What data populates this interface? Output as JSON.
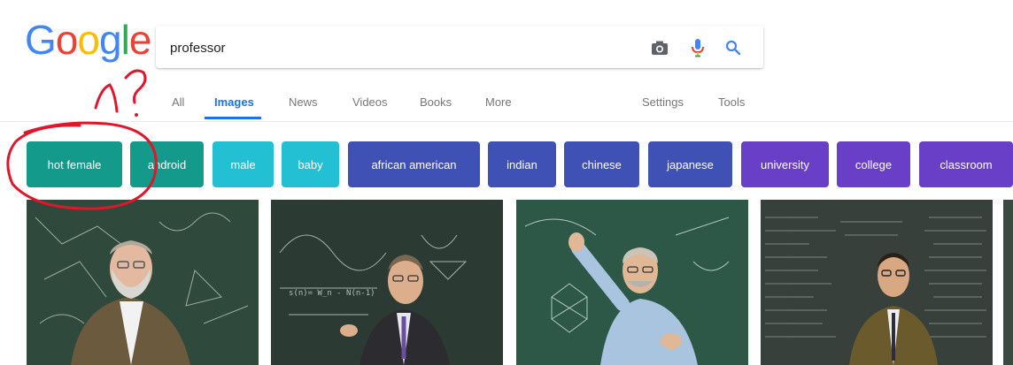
{
  "logo": {
    "letters": [
      "G",
      "o",
      "o",
      "g",
      "l",
      "e"
    ],
    "colors": [
      "#4285F4",
      "#EA4335",
      "#FBBC05",
      "#4285F4",
      "#34A853",
      "#EA4335"
    ]
  },
  "search": {
    "query": "professor",
    "camera_icon": "camera-icon",
    "mic_icon": "microphone-icon",
    "search_icon": "search-icon"
  },
  "tabs": {
    "items": [
      {
        "label": "All"
      },
      {
        "label": "Images",
        "active": true
      },
      {
        "label": "News"
      },
      {
        "label": "Videos"
      },
      {
        "label": "Books"
      },
      {
        "label": "More"
      }
    ],
    "settings_label": "Settings",
    "tools_label": "Tools",
    "accent": "#1a73e8"
  },
  "chips": [
    {
      "label": "hot female",
      "color": "#139a8a"
    },
    {
      "label": "android",
      "color": "#139a8a"
    },
    {
      "label": "male",
      "color": "#23c0d4"
    },
    {
      "label": "baby",
      "color": "#23c0d4"
    },
    {
      "label": "african american",
      "color": "#3f51b5"
    },
    {
      "label": "indian",
      "color": "#3f51b5"
    },
    {
      "label": "chinese",
      "color": "#3f51b5"
    },
    {
      "label": "japanese",
      "color": "#3f51b5"
    },
    {
      "label": "university",
      "color": "#6a3fc7"
    },
    {
      "label": "college",
      "color": "#6a3fc7"
    },
    {
      "label": "classroom",
      "color": "#6a3fc7"
    }
  ],
  "annotation": {
    "scribble_text": "?",
    "color": "#e0162b"
  }
}
